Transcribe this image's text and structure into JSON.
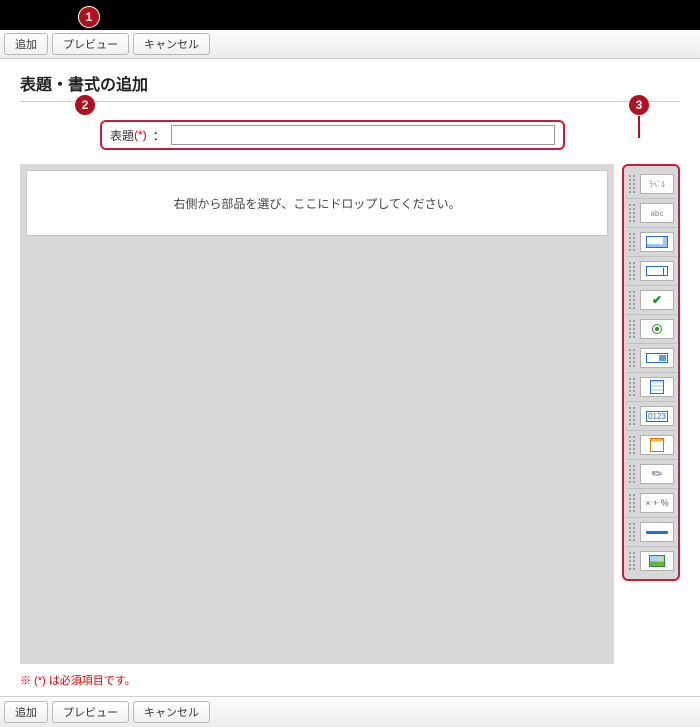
{
  "callouts": {
    "c1": "1",
    "c2": "2",
    "c3": "3"
  },
  "toolbar": {
    "add": "追加",
    "preview": "プレビュー",
    "cancel": "キャンセル"
  },
  "page": {
    "title": "表題・書式の追加",
    "title_label": "表題",
    "required_mark": "(*)",
    "colon": "：",
    "title_value": ""
  },
  "drop_hint": "右側から部品を選び、ここにドロップしてください。",
  "palette": {
    "label_text": "ﾗﾍﾞﾙ",
    "static_text": "abc",
    "number_text": "0123",
    "calc_text": "× + %"
  },
  "footnote": "※ (*) は必須項目です。"
}
